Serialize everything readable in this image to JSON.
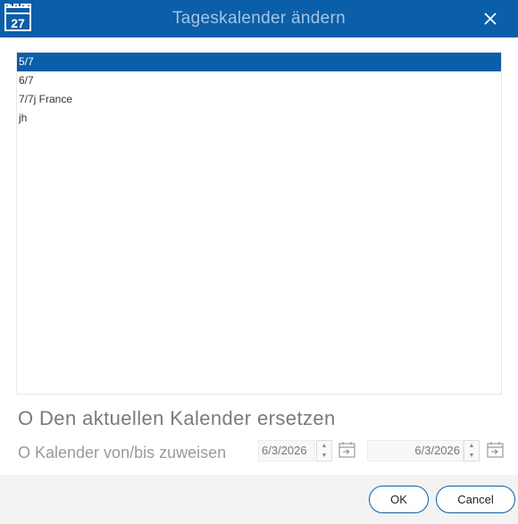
{
  "window": {
    "title": "Tageskalender ändern",
    "icon_day": "27",
    "title_color": "#0b5ea8"
  },
  "calendar_list": {
    "items": [
      {
        "label": "5/7",
        "selected": true
      },
      {
        "label": "6/7",
        "selected": false
      },
      {
        "label": "7/7j France",
        "selected": false
      },
      {
        "label": "jh",
        "selected": false
      }
    ]
  },
  "options": {
    "replace_label": "O Den aktuellen Kalender ersetzen",
    "assign_label": "O Kalender von/bis zuweisen",
    "date_from": "6/3/2026",
    "date_to": "6/3/2026"
  },
  "buttons": {
    "ok_label": "OK",
    "cancel_label": "Cancel"
  },
  "icons": {
    "app": "calendar-icon",
    "close": "close-icon",
    "date_picker": "calendar-picker-icon"
  }
}
